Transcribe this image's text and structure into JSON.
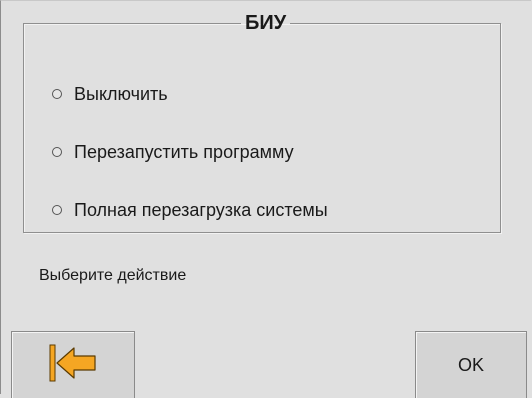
{
  "dialog": {
    "group_title": "БИУ",
    "options": [
      {
        "label": "Выключить"
      },
      {
        "label": "Перезапустить программу"
      },
      {
        "label": "Полная перезагрузка системы"
      }
    ],
    "hint": "Выберите действие",
    "back_icon": "arrow-left-to-bar-icon",
    "ok_label": "OK",
    "accent_color": "#f5a623"
  }
}
